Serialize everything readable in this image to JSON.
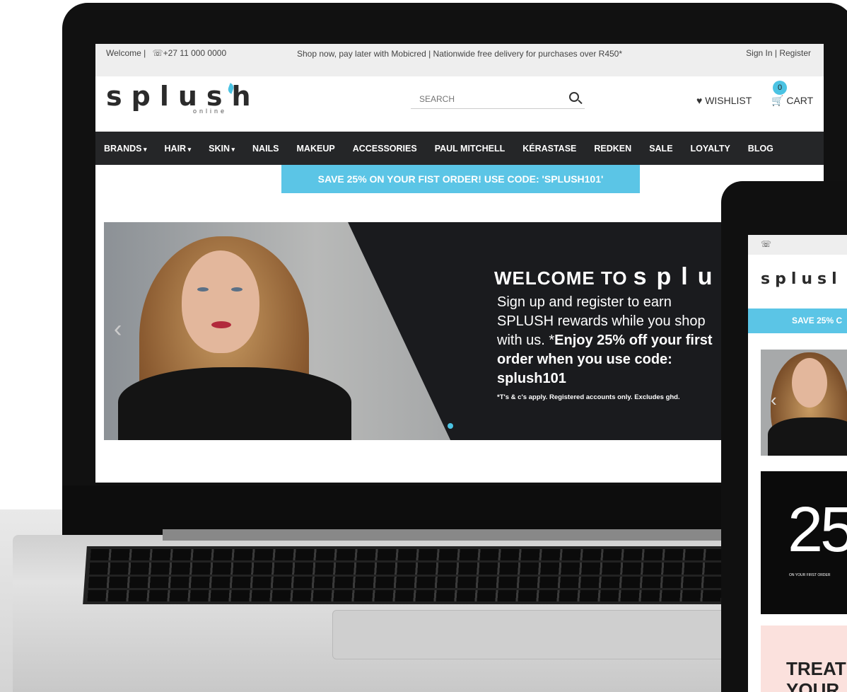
{
  "topbar": {
    "welcome": "Welcome  |",
    "phone": "☏+27 11 000 0000",
    "message": "Shop now, pay later with Mobicred   |   Nationwide free delivery for purchases over R450*",
    "account": "Sign In | Register"
  },
  "header": {
    "logo": "splush",
    "logo_sub": "online",
    "search_placeholder": "SEARCH",
    "wishlist_label": "♥ WISHLIST",
    "cart_label": "CART",
    "cart_count": "0"
  },
  "nav": {
    "items": [
      {
        "label": "BRANDS",
        "dropdown": true
      },
      {
        "label": "HAIR",
        "dropdown": true
      },
      {
        "label": "SKIN",
        "dropdown": true
      },
      {
        "label": "NAILS"
      },
      {
        "label": "MAKEUP"
      },
      {
        "label": "ACCESSORIES"
      },
      {
        "label": "PAUL MITCHELL"
      },
      {
        "label": "KÉRASTASE"
      },
      {
        "label": "REDKEN"
      },
      {
        "label": "SALE"
      },
      {
        "label": "LOYALTY"
      },
      {
        "label": "BLOG"
      }
    ]
  },
  "promo": {
    "text": "SAVE 25% ON YOUR FIST ORDER! USE CODE: 'SPLUSH101'"
  },
  "hero": {
    "prev_arrow": "‹",
    "title_prefix": "WELCOME TO",
    "title_brand": "splu",
    "text_plain": "Sign up and register to earn SPLUSH rewards while you shop with us. *",
    "text_bold": "Enjoy 25% off your first order when you use code: splush101",
    "fine_print": "*T's & c's apply. Registered accounts only.  Excludes ghd."
  },
  "tablet": {
    "phone_icon": "☏",
    "logo": "splusl",
    "promo": "SAVE 25% C",
    "prev_arrow": "‹",
    "big_number": "25",
    "small_caption": "ON YOUR FIRST ORDER",
    "treat_line1": "TREAT",
    "treat_line2": "YOUR"
  },
  "colors": {
    "accent": "#5bc5e6",
    "nav_bg": "#252628",
    "hero_bg": "#1a1b1e",
    "topbar_bg": "#eeeeee"
  }
}
